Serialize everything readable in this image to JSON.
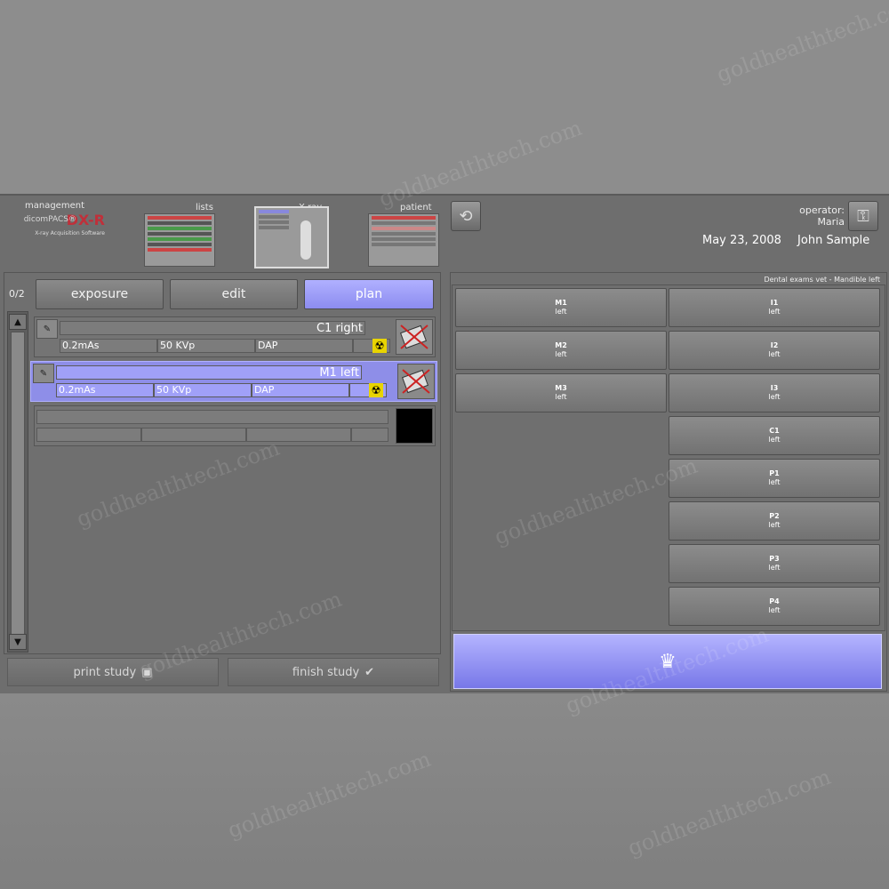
{
  "header": {
    "brand_section_label": "management",
    "brand_logo": "DX-R",
    "brand_pacs": "dicomPACS®",
    "brand_sub": "X-ray Acquisition Software",
    "lists_label": "lists",
    "xray_label": "X-ray",
    "patient_label": "patient",
    "operator_label": "operator:",
    "operator_name": "Maria",
    "patient_name": "John Sample",
    "study_date": "May 23, 2008"
  },
  "tabs": [
    {
      "label": "plan"
    },
    {
      "label": "edit"
    },
    {
      "label": "exposure"
    }
  ],
  "exposure_count": "0/2",
  "exposures": [
    {
      "name": "C1 right",
      "mas": "0.2mAs",
      "kvp": "50 KVp",
      "dap": "DAP"
    },
    {
      "name": "M1 left",
      "mas": "0.2mAs",
      "kvp": "50 KVp",
      "dap": "DAP"
    }
  ],
  "footer": {
    "print_study": "print study",
    "finish_study": "finish study"
  },
  "right_panel": {
    "title": "Dental exams vet - Mandible left",
    "left_column": [
      {
        "code": "M1",
        "side": "left"
      },
      {
        "code": "M2",
        "side": "left"
      },
      {
        "code": "M3",
        "side": "left"
      }
    ],
    "right_column": [
      {
        "code": "I1",
        "side": "left"
      },
      {
        "code": "I2",
        "side": "left"
      },
      {
        "code": "I3",
        "side": "left"
      },
      {
        "code": "C1",
        "side": "left"
      },
      {
        "code": "P1",
        "side": "left"
      },
      {
        "code": "P2",
        "side": "left"
      },
      {
        "code": "P3",
        "side": "left"
      },
      {
        "code": "P4",
        "side": "left"
      }
    ]
  },
  "watermark": "goldhealthtech.com",
  "colors": {
    "accent": "#9a9af4",
    "screen": "#6e6e6e",
    "brand": "#c0303a"
  }
}
